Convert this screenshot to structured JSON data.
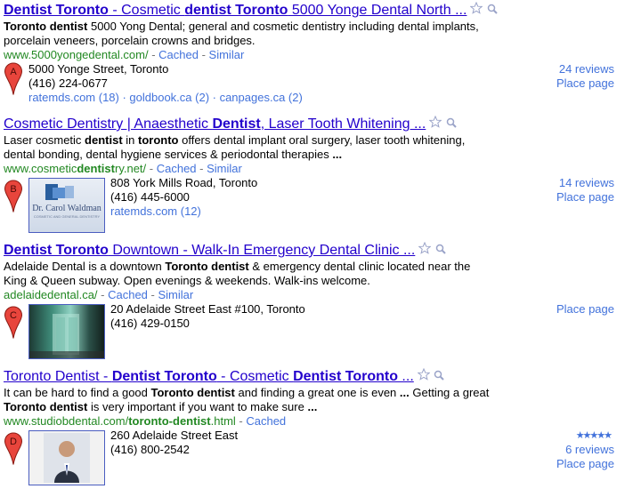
{
  "results": [
    {
      "title_parts": [
        {
          "t": "Dentist Toronto",
          "b": true
        },
        {
          "t": " - Cosmetic ",
          "b": false
        },
        {
          "t": "dentist Toronto",
          "b": true
        },
        {
          "t": " 5000 Yonge Dental North ...",
          "b": false
        }
      ],
      "snippet_lines": [
        [
          {
            "t": "Toronto dentist",
            "b": true
          },
          {
            "t": " 5000 Yong Dental; general and cosmetic dentistry including dental implants,",
            "b": false
          }
        ],
        [
          {
            "t": "porcelain veneers, porcelain crowns and bridges.",
            "b": false
          }
        ]
      ],
      "url": "www.5000yongedental.com/",
      "cached": "Cached",
      "similar": "Similar",
      "pin_letter": "A",
      "address": "5000 Yonge Street, Toronto",
      "phone": "(416) 224-0677",
      "sources": "ratemds.com (18) · goldbook.ca (2) · canpages.ca (2)",
      "reviews": "24 reviews",
      "place_page": "Place page"
    },
    {
      "title_parts": [
        {
          "t": "Cosmetic Dentistry | Anaesthetic ",
          "b": false
        },
        {
          "t": "Dentist",
          "b": true
        },
        {
          "t": ", Laser Tooth Whitening ...",
          "b": false
        }
      ],
      "snippet_lines": [
        [
          {
            "t": "Laser cosmetic ",
            "b": false
          },
          {
            "t": "dentist",
            "b": true
          },
          {
            "t": " in ",
            "b": false
          },
          {
            "t": "toronto",
            "b": true
          },
          {
            "t": " offers dental implant oral surgery, laser tooth whitening,",
            "b": false
          }
        ],
        [
          {
            "t": "dental bonding, dental hygiene services & periodontal therapies ",
            "b": false
          },
          {
            "t": "...",
            "b": true
          }
        ]
      ],
      "url_parts": [
        {
          "t": "www.cosmetic",
          "b": false
        },
        {
          "t": "dentist",
          "b": true
        },
        {
          "t": "ry.net/",
          "b": false
        }
      ],
      "cached": "Cached",
      "similar": "Similar",
      "pin_letter": "B",
      "thumb_caption": "Dr. Carol Waldman",
      "thumb_sub": "COSMETIC AND GENERAL DENTISTRY",
      "address": "808 York Mills Road, Toronto",
      "phone": "(416) 445-6000",
      "sources": "ratemds.com (12)",
      "reviews": "14 reviews",
      "place_page": "Place page"
    },
    {
      "title_parts": [
        {
          "t": "Dentist Toronto",
          "b": true
        },
        {
          "t": " Downtown - Walk-In Emergency Dental Clinic ...",
          "b": false
        }
      ],
      "snippet_lines": [
        [
          {
            "t": "Adelaide Dental is a downtown ",
            "b": false
          },
          {
            "t": "Toronto dentist",
            "b": true
          },
          {
            "t": " & emergency dental clinic located near the",
            "b": false
          }
        ],
        [
          {
            "t": "King & Queen subway. Open evenings & weekends. Walk-ins welcome.",
            "b": false
          }
        ]
      ],
      "url": "adelaidedental.ca/",
      "cached": "Cached",
      "similar": "Similar",
      "pin_letter": "C",
      "address": "20 Adelaide Street East #100, Toronto",
      "phone": "(416) 429-0150",
      "place_page": "Place page"
    },
    {
      "title_parts": [
        {
          "t": "Toronto Dentist - ",
          "b": false
        },
        {
          "t": "Dentist Toronto",
          "b": true
        },
        {
          "t": " - Cosmetic ",
          "b": false
        },
        {
          "t": "Dentist Toronto",
          "b": true
        },
        {
          "t": " ...",
          "b": false
        }
      ],
      "snippet_lines": [
        [
          {
            "t": "It can be hard to find a good ",
            "b": false
          },
          {
            "t": "Toronto dentist",
            "b": true
          },
          {
            "t": " and finding a great one is even ",
            "b": false
          },
          {
            "t": "...",
            "b": true
          },
          {
            "t": " Getting a great",
            "b": false
          }
        ],
        [
          {
            "t": "Toronto dentist",
            "b": true
          },
          {
            "t": " is very important if you want to make sure ",
            "b": false
          },
          {
            "t": "...",
            "b": true
          }
        ]
      ],
      "url_parts": [
        {
          "t": "www.studiobdental.com/",
          "b": false
        },
        {
          "t": "toronto-dentist",
          "b": true
        },
        {
          "t": ".html",
          "b": false
        }
      ],
      "cached": "Cached",
      "pin_letter": "D",
      "address": "260 Adelaide Street East",
      "phone": "(416) 800-2542",
      "stars": "★★★★★",
      "reviews": "6 reviews",
      "place_page": "Place page"
    }
  ],
  "colors": {
    "link": "#2200cc",
    "url_green": "#228822",
    "secondary_link": "#4272db",
    "pin_red": "#e8453c",
    "star_gold": "#f4b400"
  },
  "icons": {
    "star": "star-icon",
    "magnifier": "magnifier-icon",
    "pin": "map-pin-icon"
  }
}
